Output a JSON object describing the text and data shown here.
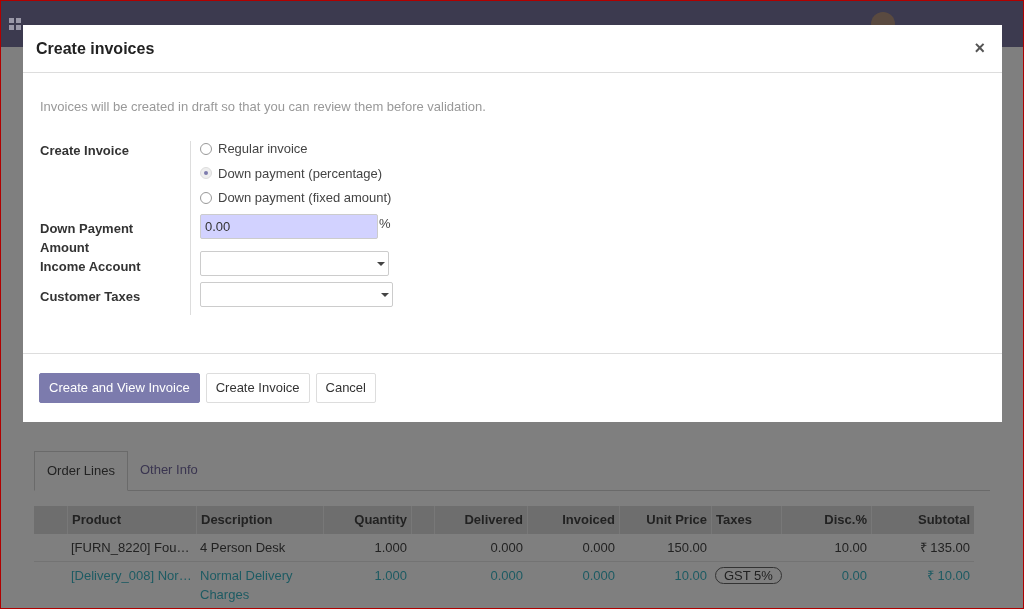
{
  "dialog": {
    "title": "Create invoices",
    "close": "×",
    "note": "Invoices will be created in draft so that you can review them before validation.",
    "create_invoice": {
      "label": "Create Invoice",
      "options": [
        {
          "label": "Regular invoice",
          "selected": false
        },
        {
          "label": "Down payment (percentage)",
          "selected": true
        },
        {
          "label": "Down payment (fixed amount)",
          "selected": false
        }
      ]
    },
    "down_payment": {
      "label": "Down Payment Amount",
      "value": "0.00",
      "unit": "%"
    },
    "income_account": {
      "label": "Income Account"
    },
    "customer_taxes": {
      "label": "Customer Taxes"
    },
    "buttons": [
      {
        "label": "Create and View Invoice",
        "kind": "primary"
      },
      {
        "label": "Create Invoice",
        "kind": "secondary"
      },
      {
        "label": "Cancel",
        "kind": "secondary"
      }
    ]
  },
  "tabs": [
    {
      "label": "Order Lines",
      "selected": true
    },
    {
      "label": "Other Info",
      "selected": false
    }
  ],
  "table": {
    "columns": [
      "Product",
      "Description",
      "Quantity",
      "",
      "Delivered",
      "Invoiced",
      "Unit Price",
      "Taxes",
      "Disc.%",
      "Subtotal"
    ],
    "rows": [
      {
        "kind": "product",
        "cells": [
          "[FURN_8220] Fou…",
          "4 Person Desk",
          "1.000",
          "",
          "0.000",
          "0.000",
          "150.00",
          "",
          "10.00",
          "₹ 135.00"
        ]
      },
      {
        "kind": "service",
        "cells": [
          "[Delivery_008] Nor…",
          "Normal Delivery Charges",
          "1.000",
          "",
          "0.000",
          "0.000",
          "10.00",
          "GST 5%",
          "0.00",
          "₹ 10.00"
        ]
      }
    ]
  }
}
